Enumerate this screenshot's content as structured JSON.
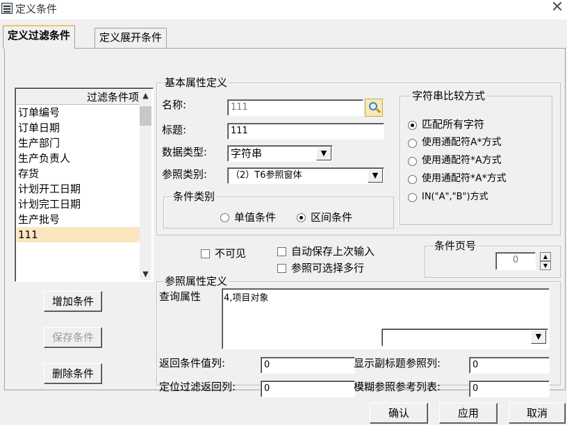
{
  "window": {
    "title": "定义条件"
  },
  "tabs": [
    {
      "label": "定义过滤条件"
    },
    {
      "label": "定义展开条件"
    }
  ],
  "filter_list": {
    "header": "过滤条件项",
    "items": [
      "订单编号",
      "订单日期",
      "生产部门",
      "生产负责人",
      "存货",
      "计划开工日期",
      "计划完工日期",
      "生产批号",
      "111"
    ],
    "selected": "111"
  },
  "buttons": {
    "add": "增加条件",
    "save": "保存条件",
    "delete": "删除条件",
    "ok": "确认",
    "apply": "应用",
    "cancel": "取消"
  },
  "basic": {
    "legend": "基本属性定义",
    "name_label": "名称:",
    "name_value": "111",
    "title_label": "标题:",
    "title_value": "111",
    "datatype_label": "数据类型:",
    "datatype_value": "字符串",
    "reftype_label": "参照类别:",
    "reftype_value": "（2）T6参照窗体"
  },
  "condition_type": {
    "legend": "条件类别",
    "options": [
      "单值条件",
      "区间条件"
    ],
    "selected": "区间条件"
  },
  "string_compare": {
    "legend": "字符串比较方式",
    "options": [
      "匹配所有字符",
      "使用通配符A*方式",
      "使用通配符*A方式",
      "使用通配符*A*方式",
      "IN(\"A\",\"B\")方式"
    ],
    "selected": "匹配所有字符"
  },
  "checkboxes": {
    "invisible": "不可见",
    "autosave": "自动保存上次输入",
    "multirow": "参照可选择多行"
  },
  "page": {
    "legend": "条件页号",
    "value": "0"
  },
  "reference": {
    "legend": "参照属性定义",
    "query_label": "查询属性",
    "query_value": "4,项目对象",
    "return_label": "返回条件值列:",
    "return_value": "0",
    "display_label": "显示副标题参照列:",
    "display_value": "0",
    "locate_label": "定位过滤返回列:",
    "locate_value": "0",
    "fuzzy_label": "模糊参照参考列表:",
    "fuzzy_value": "0"
  }
}
